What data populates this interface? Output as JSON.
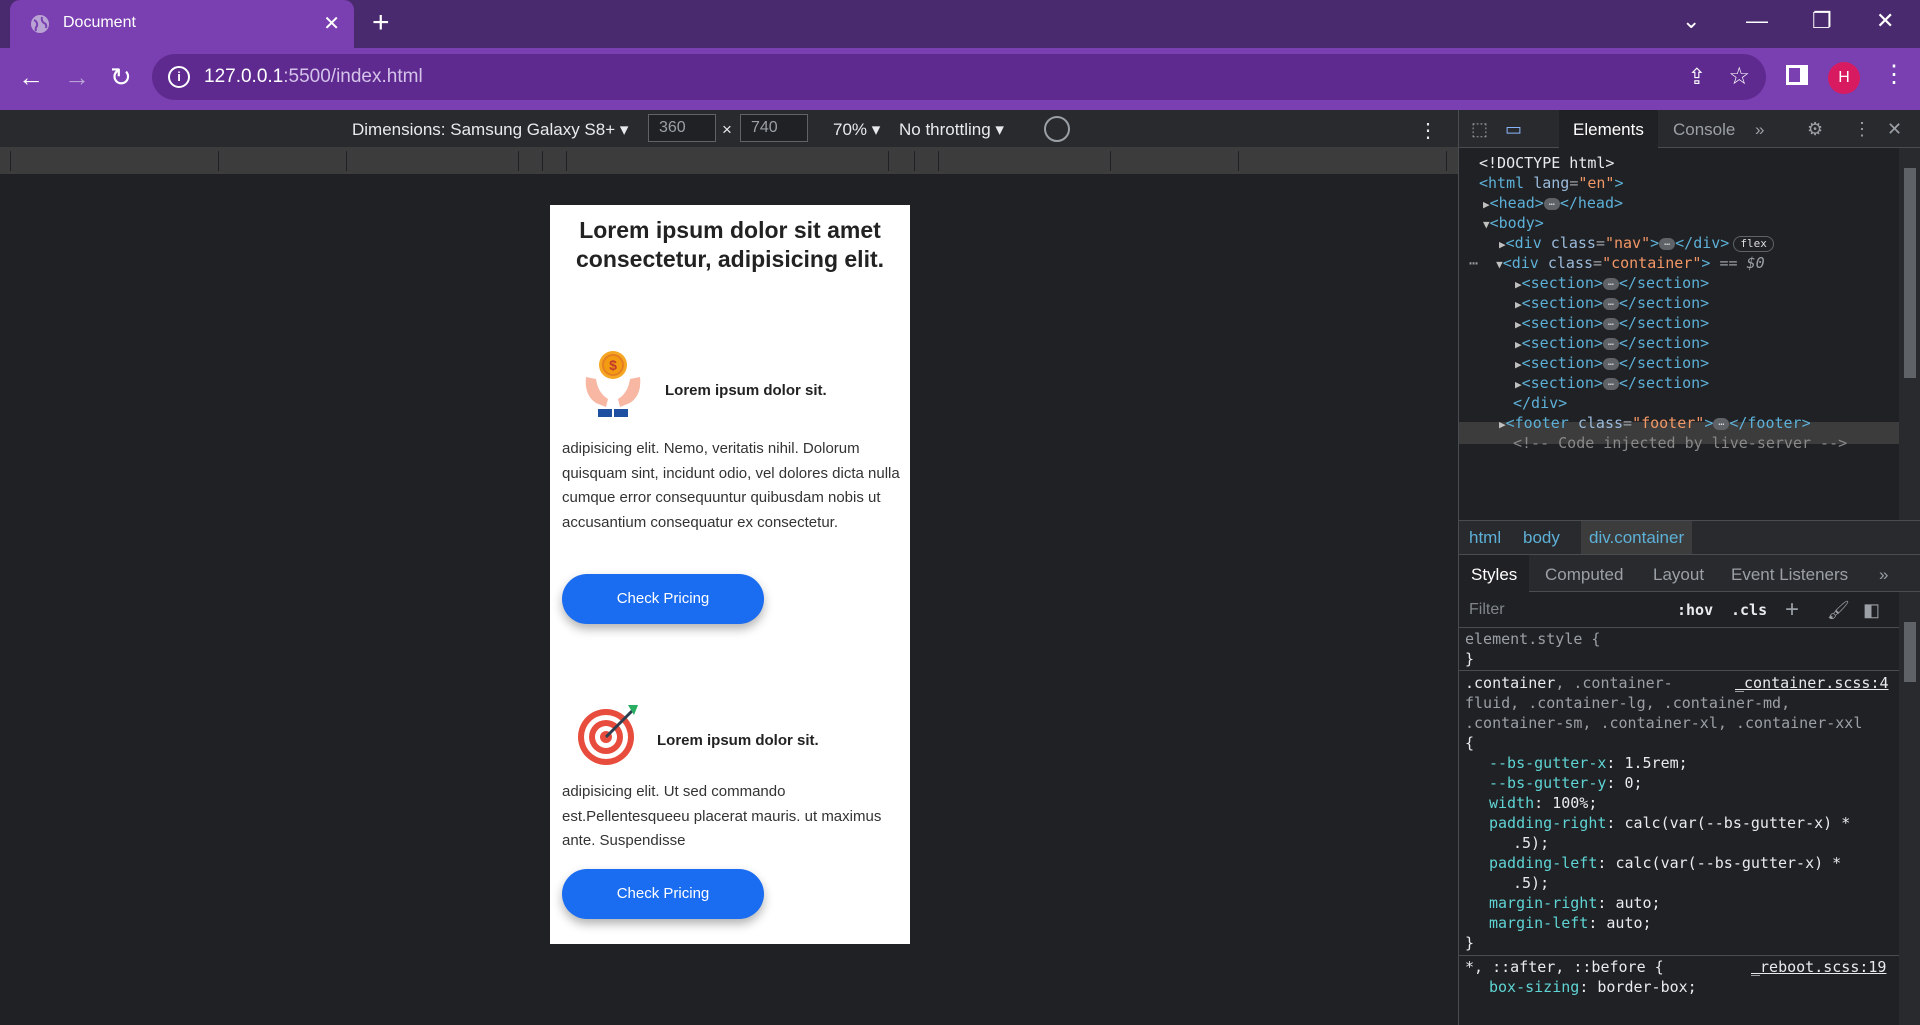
{
  "browser": {
    "tab_title": "Document",
    "new_tab": "+",
    "url_host": "127.0.0.1",
    "url_rest": ":5500/index.html",
    "avatar_initial": "H"
  },
  "device_toolbar": {
    "dimensions_label": "Dimensions: Samsung Galaxy S8+",
    "width": "360",
    "height": "740",
    "times": "×",
    "zoom": "70%",
    "throttling": "No throttling"
  },
  "page": {
    "heading": "Lorem ipsum dolor sit amet consectetur, adipisicing elit.",
    "features": [
      {
        "icon": "money-hands-icon",
        "title": "Lorem ipsum dolor sit.",
        "text": "adipisicing elit. Nemo, veritatis nihil. Dolorum quisquam sint, incidunt odio, vel dolores dicta nulla cumque error consequuntur quibusdam nobis ut accusantium consequatur ex consectetur.",
        "button": "Check Pricing"
      },
      {
        "icon": "target-icon",
        "title": "Lorem ipsum dolor sit.",
        "text": "adipisicing elit. Ut sed commando est.Pellentesqueeu placerat mauris. ut maximus ante. Suspendisse",
        "button": "Check Pricing"
      }
    ]
  },
  "devtools": {
    "tabs": {
      "elements": "Elements",
      "console": "Console",
      "more": "»"
    },
    "dom": {
      "doctype": "<!DOCTYPE html>",
      "html_tag": "<html",
      "html_attr": "lang",
      "html_val": "\"en\"",
      "html_close": ">",
      "head_open": "<head>",
      "head_close": "</head>",
      "body_open": "<body>",
      "nav_open": "<div",
      "nav_attr": "class",
      "nav_val": "\"nav\"",
      "nav_close": "</div>",
      "flex_badge": "flex",
      "container_open": "<div",
      "container_attr": "class",
      "container_val": "\"container\"",
      "container_sel": "== $0",
      "section_open": "<section>",
      "section_close": "</section>",
      "div_close": "</div>",
      "footer_open": "<footer",
      "footer_attr": "class",
      "footer_val": "\"footer\"",
      "footer_close": "</footer>",
      "comment": "<!-- Code injected by live-server -->"
    },
    "breadcrumbs": [
      "html",
      "body",
      "div.container"
    ],
    "sub_tabs": {
      "styles": "Styles",
      "computed": "Computed",
      "layout": "Layout",
      "listeners": "Event Listeners",
      "more": "»"
    },
    "filter_placeholder": "Filter",
    "hov": ":hov",
    "cls": ".cls",
    "styles": {
      "element_style": "element.style {",
      "close_brace": "}",
      "open_brace": "{",
      "container_selector": ".container",
      "container_more1": ", .container-",
      "container_more2": "fluid, .container-lg, .container-md,",
      "container_more3": ".container-sm, .container-xl, .container-xxl",
      "container_source": "_container.scss:4",
      "decls": [
        {
          "name": "--bs-gutter-x",
          "value": "1.5rem;"
        },
        {
          "name": "--bs-gutter-y",
          "value": "0;"
        },
        {
          "name": "width",
          "value": "100%;"
        },
        {
          "name": "padding-right",
          "value": "calc(var(--bs-gutter-x) *"
        },
        {
          "name": "",
          "value": ".5);"
        },
        {
          "name": "padding-left",
          "value": "calc(var(--bs-gutter-x) *"
        },
        {
          "name": "",
          "value": ".5);"
        },
        {
          "name": "margin-right",
          "value": "auto;"
        },
        {
          "name": "margin-left",
          "value": "auto;"
        }
      ],
      "reboot_selector": "*, ::after, ::before {",
      "reboot_source": "_reboot.scss:19",
      "reboot_decl_name": "box-sizing",
      "reboot_decl_value": "border-box;"
    }
  }
}
